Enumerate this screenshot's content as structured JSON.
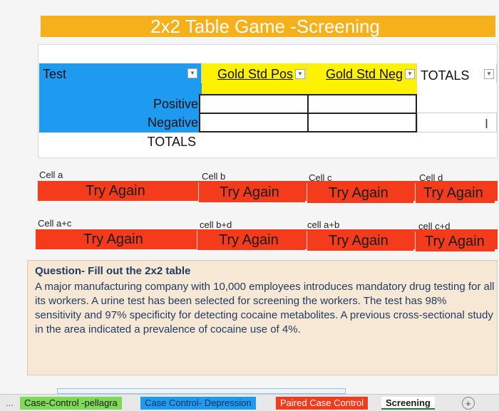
{
  "sheet_title": "2x2 Table Game -Screening",
  "header": {
    "test": "Test",
    "gold_pos": "Gold Std Pos",
    "gold_neg": "Gold Std Neg",
    "totals": "TOTALS"
  },
  "rows": {
    "positive": "Positive",
    "negative": "Negative",
    "totals": "TOTALS"
  },
  "cells_row1": {
    "a_label": "Cell a",
    "b_label": "Cell b",
    "c_label": "Cell c",
    "d_label": "Cell d",
    "a_result": "Try Again",
    "b_result": "Try Again",
    "c_result": "Try Again",
    "d_result": "Try Again"
  },
  "cells_row2": {
    "ac_label": "Cell a+c",
    "bd_label": "cell b+d",
    "ab_label": "cell a+b",
    "cd_label": "cell c+d",
    "ac_result": "Try Again",
    "bd_result": "Try Again",
    "ab_result": "Try Again",
    "cd_result": "Try Again"
  },
  "question": {
    "title": "Question- Fill out the 2x2 table",
    "body": "A major manufacturing company with 10,000 employees introduces mandatory drug testing for all its workers. A urine test has been selected for screening the workers. The test has 98% sensitivity and 97% specificity for detecting cocaine metabolites. A previous cross-sectional study in the area indicated a prevalence of cocaine use of 4%."
  },
  "tabs": {
    "more": "...",
    "t1": "Case-Control -pellagra",
    "t2": "Case Control- Depression",
    "t3": "Paired Case Control",
    "t4": "Screening",
    "add": "+"
  },
  "colors": {
    "title_bar": "#f5b01c",
    "header_blue": "#1e9bf0",
    "header_yellow": "#fff200",
    "try_red": "#f43b1c",
    "tab1": "#7ed957",
    "tab2": "#1e9bf0",
    "tab3": "#f43b1c"
  }
}
